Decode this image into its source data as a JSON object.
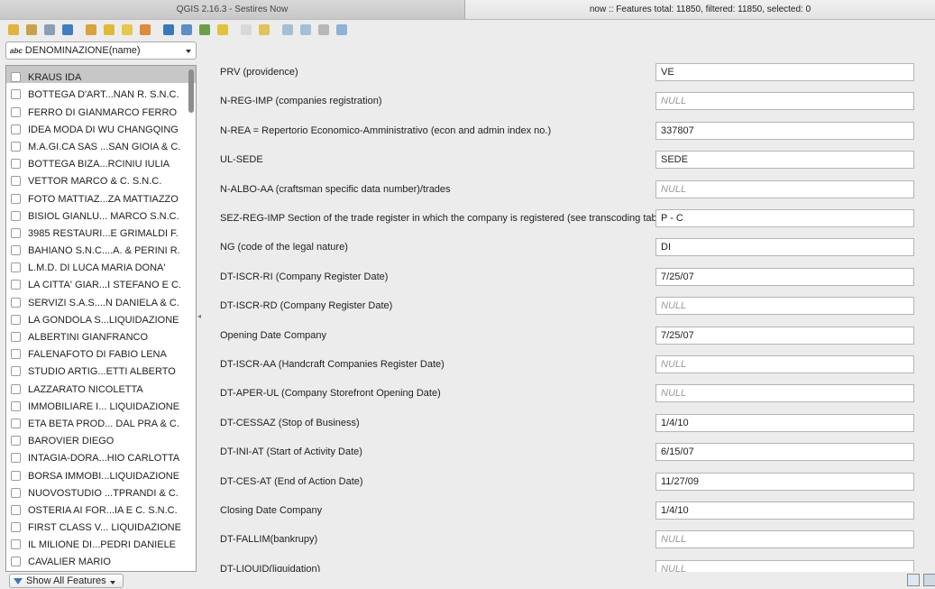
{
  "window": {
    "tab_left": "QGIS 2.16.3 - Sestires Now",
    "tab_right": "now :: Features total: 11850, filtered: 11850, selected: 0"
  },
  "toolbar": {
    "icons": [
      {
        "name": "toggle-edit-icon",
        "color": "#e3b43a"
      },
      {
        "name": "save-edits-icon",
        "color": "#c8a24a"
      },
      {
        "name": "save-icon",
        "color": "#8a9fb6"
      },
      {
        "name": "reload-icon",
        "color": "#3f7fbf"
      },
      {
        "name": "add-feature-icon",
        "color": "#d9a23a"
      },
      {
        "name": "delete-feature-icon",
        "color": "#e2b837"
      },
      {
        "name": "invert-selection-icon",
        "color": "#e6c84a"
      },
      {
        "name": "deselect-icon",
        "color": "#e08a3a"
      },
      {
        "name": "filter-icon",
        "color": "#3b78b8"
      },
      {
        "name": "move-selection-top-icon",
        "color": "#5a8fc8"
      },
      {
        "name": "pan-to-selection-icon",
        "color": "#6a9f4a"
      },
      {
        "name": "zoom-to-selection-icon",
        "color": "#e1c23a"
      },
      {
        "name": "copy-icon",
        "color": "#d8d8d8"
      },
      {
        "name": "paste-icon",
        "color": "#e2c35a"
      },
      {
        "name": "field-calculator-icon",
        "color": "#a5bfd6"
      },
      {
        "name": "delete-field-icon",
        "color": "#a5bfd6"
      },
      {
        "name": "table-view-icon",
        "color": "#b7b7b7"
      },
      {
        "name": "form-view-icon",
        "color": "#8fb1d8"
      }
    ]
  },
  "left": {
    "expression": "DENOMINAZIONE(name)",
    "expression_prefix": "abc",
    "items": [
      "KRAUS IDA",
      "BOTTEGA D'ART...NAN R. S.N.C.",
      "FERRO DI GIANMARCO FERRO",
      "IDEA MODA DI WU CHANGQING",
      "M.A.GI.CA SAS ...SAN GIOIA & C.",
      "BOTTEGA BIZA...RCINIU IULIA",
      "VETTOR MARCO & C. S.N.C.",
      "FOTO MATTIAZ...ZA MATTIAZZO",
      "BISIOL GIANLU... MARCO S.N.C.",
      "3985 RESTAURI...E GRIMALDI F.",
      "BAHIANO S.N.C....A. & PERINI R.",
      "L.M.D. DI LUCA MARIA DONA'",
      "LA CITTA' GIAR...I STEFANO E C.",
      "SERVIZI S.A.S....N DANIELA & C.",
      "LA GONDOLA S...LIQUIDAZIONE",
      "ALBERTINI GIANFRANCO",
      "FALENAFOTO DI FABIO LENA",
      "STUDIO ARTIG...ETTI ALBERTO",
      "LAZZARATO NICOLETTA",
      "IMMOBILIARE I... LIQUIDAZIONE",
      "ETA BETA PROD... DAL PRA & C.",
      "BAROVIER DIEGO",
      "INTAGIA-DORA...HIO CARLOTTA",
      "BORSA IMMOBI...LIQUIDAZIONE",
      "NUOVOSTUDIO ...TPRANDI & C.",
      "OSTERIA AI FOR...IA E C. S.N.C.",
      "FIRST CLASS V... LIQUIDAZIONE",
      "IL MILIONE DI...PEDRI DANIELE",
      "CAVALIER MARIO"
    ]
  },
  "form": {
    "fields": [
      {
        "label": "PRV (providence)",
        "value": "VE",
        "is_null": false
      },
      {
        "label": "N-REG-IMP (companies registration)",
        "value": "NULL",
        "is_null": true
      },
      {
        "label": "N-REA =  Repertorio Economico-Amministrativo (econ and admin index no.)",
        "value": "337807",
        "is_null": false
      },
      {
        "label": "UL-SEDE",
        "value": "SEDE",
        "is_null": false
      },
      {
        "label": "N-ALBO-AA (craftsman specific data number)/trades",
        "value": "NULL",
        "is_null": true
      },
      {
        "label": "SEZ-REG-IMP Section of the trade register in which the company is registered (see transcoding table)",
        "value": "P - C",
        "is_null": false
      },
      {
        "label": "NG (code of the legal nature)",
        "value": "DI",
        "is_null": false
      },
      {
        "label": "DT-ISCR-RI (Company Register Date)",
        "value": "7/25/07",
        "is_null": false
      },
      {
        "label": "DT-ISCR-RD (Company Register Date)",
        "value": "NULL",
        "is_null": true
      },
      {
        "label": "Opening Date Company",
        "value": "7/25/07",
        "is_null": false
      },
      {
        "label": "DT-ISCR-AA (Handcraft Companies Register Date)",
        "value": "NULL",
        "is_null": true
      },
      {
        "label": "DT-APER-UL (Company Storefront Opening Date)",
        "value": "NULL",
        "is_null": true
      },
      {
        "label": "DT-CESSAZ (Stop of Business)",
        "value": "1/4/10",
        "is_null": false
      },
      {
        "label": "DT-INI-AT (Start of Activity Date)",
        "value": "6/15/07",
        "is_null": false
      },
      {
        "label": "DT-CES-AT (End of Action Date)",
        "value": "11/27/09",
        "is_null": false
      },
      {
        "label": "Closing Date Company",
        "value": "1/4/10",
        "is_null": false
      },
      {
        "label": "DT-FALLIM(bankrupy)",
        "value": "NULL",
        "is_null": true
      },
      {
        "label": "DT-LIQUID(liquidation)",
        "value": "NULL",
        "is_null": true
      }
    ]
  },
  "bottom": {
    "show_all_label": "Show All Features"
  }
}
